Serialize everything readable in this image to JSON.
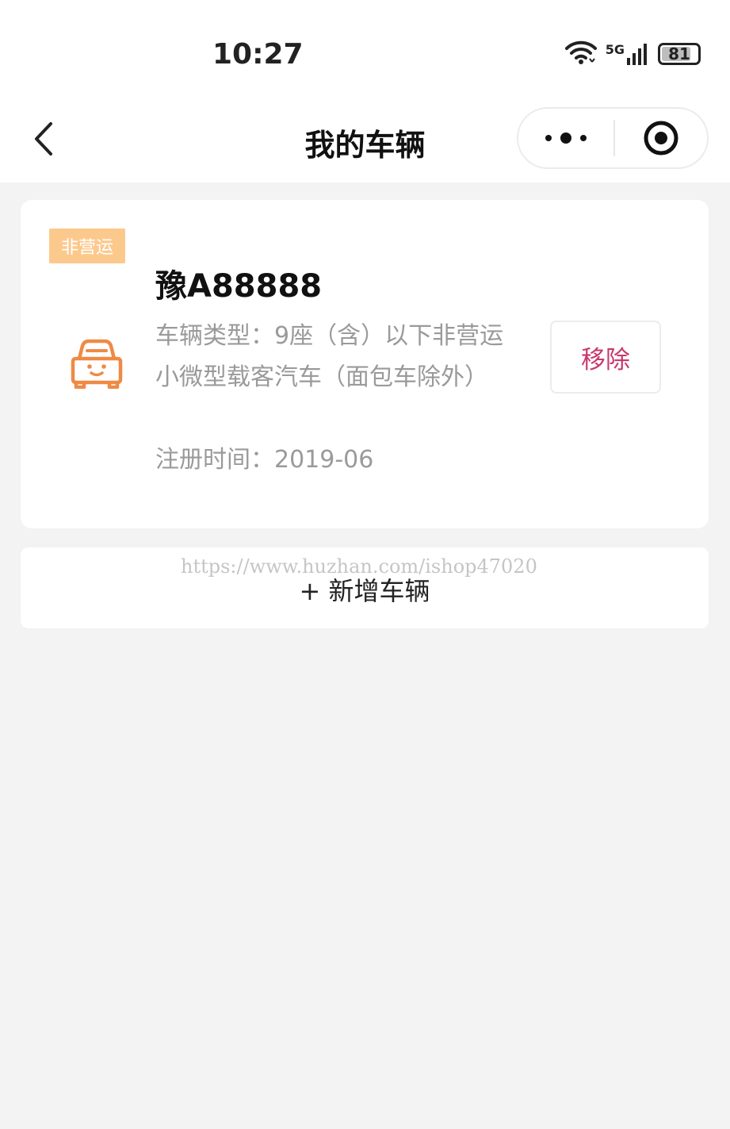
{
  "status_bar": {
    "time": "10:27",
    "network": "5G",
    "battery": "81",
    "battery_level": 0.81,
    "icons": [
      "wifi-icon",
      "signal-icon",
      "battery-icon"
    ]
  },
  "nav": {
    "title": "我的车辆",
    "back_icon": "chevron-left-icon",
    "more_icon": "more-dots-icon",
    "close_icon": "target-close-icon"
  },
  "vehicle": {
    "badge": "非营运",
    "plate": "豫A88888",
    "type_text": "车辆类型：9座（含）以下非营运小微型载客汽车（面包车除外）",
    "reg_text": "注册时间：2019-06",
    "remove_label": "移除",
    "icon": "car-icon"
  },
  "add": {
    "label": "+ 新增车辆"
  },
  "watermark": "https://www.huzhan.com/ishop47020",
  "colors": {
    "background": "#f3f3f3",
    "badge": "#fcc98d",
    "car_icon": "#ef8a45",
    "remove_text": "#c8386c",
    "secondary_text": "#9a9a9a"
  }
}
